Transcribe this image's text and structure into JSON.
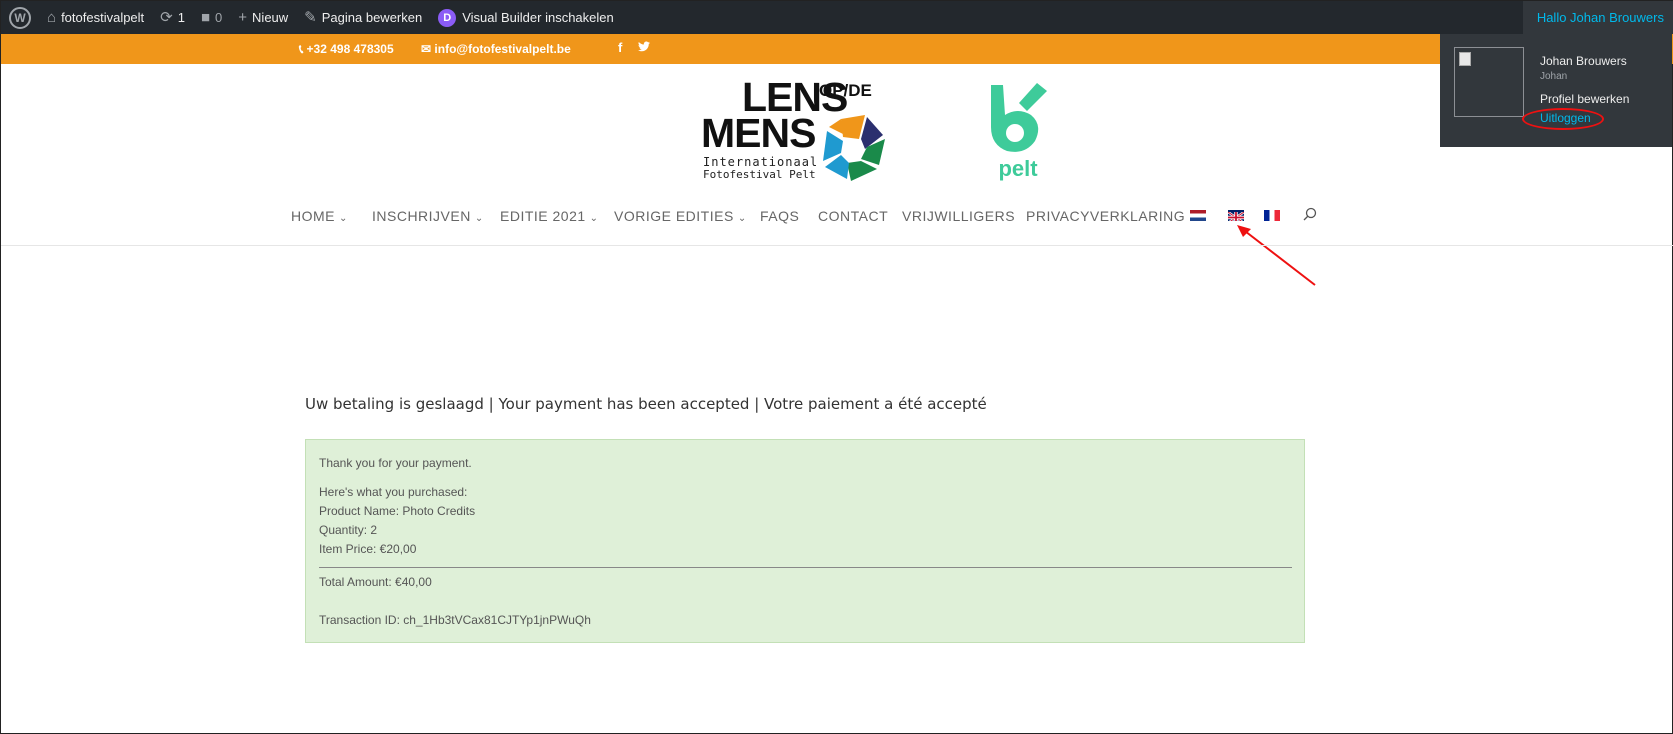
{
  "admin_bar": {
    "site_name": "fotofestivalpelt",
    "updates_count": "1",
    "comments_count": "0",
    "new_label": "Nieuw",
    "edit_page_label": "Pagina bewerken",
    "visual_builder_label": "Visual Builder inschakelen",
    "greeting": "Hallo Johan Brouwers"
  },
  "user_dropdown": {
    "display_name": "Johan Brouwers",
    "username": "Johan",
    "edit_profile": "Profiel bewerken",
    "logout": "Uitloggen"
  },
  "top_bar": {
    "phone": "+32 498 478305",
    "email": "info@fotofestivalpelt.be",
    "facebook": "f",
    "twitter": "🐦"
  },
  "logo": {
    "line1": "LENS",
    "op_de": "OP/DE",
    "line2": "MENS",
    "subtitle1": "Internationaal",
    "subtitle2": "Fotofestival Pelt",
    "partner": "pelt"
  },
  "nav": {
    "items": [
      {
        "label": "HOME",
        "dropdown": true
      },
      {
        "label": "INSCHRIJVEN",
        "dropdown": true
      },
      {
        "label": "EDITIE 2021",
        "dropdown": true
      },
      {
        "label": "VORIGE EDITIES",
        "dropdown": true
      },
      {
        "label": "FAQS",
        "dropdown": false
      },
      {
        "label": "CONTACT",
        "dropdown": false
      },
      {
        "label": "VRIJWILLIGERS",
        "dropdown": false
      },
      {
        "label": "PRIVACYVERKLARING",
        "dropdown": false
      }
    ],
    "languages": [
      "nl",
      "en",
      "fr"
    ]
  },
  "main": {
    "title": "Uw betaling is geslaagd | Your payment has been accepted | Votre paiement a été accepté",
    "payment": {
      "thanks": "Thank you for your payment.",
      "purchased_heading": "Here's what you purchased:",
      "product": "Product Name: Photo Credits",
      "quantity": "Quantity: 2",
      "item_price": "Item Price: €20,00",
      "total": "Total Amount: €40,00",
      "transaction": "Transaction ID: ch_1Hb3tVCax81CJTYp1jnPWuQh"
    }
  },
  "colors": {
    "admin_bar": "#23282d",
    "top_bar": "#f0961a",
    "success_box": "#dff0d8",
    "link": "#00b9eb",
    "pelt_green": "#3ecb9a"
  }
}
